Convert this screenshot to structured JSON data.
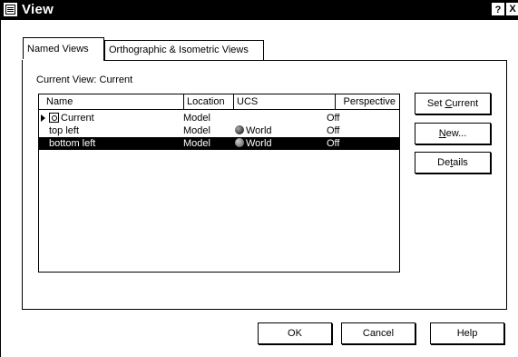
{
  "window": {
    "title": "View",
    "help_glyph": "?",
    "close_glyph": "X"
  },
  "tabs": [
    {
      "label": "Named Views",
      "active": true
    },
    {
      "label": "Orthographic & Isometric Views",
      "active": false
    }
  ],
  "current_view": {
    "label": "Current View:",
    "value": "Current"
  },
  "list": {
    "columns": [
      "Name",
      "Location",
      "UCS",
      "Perspective"
    ],
    "rows": [
      {
        "name": "Current",
        "location": "Model",
        "ucs": "",
        "perspective": "Off",
        "selected": false,
        "icons": [
          "current-arrow-icon",
          "camera-icon"
        ]
      },
      {
        "name": "top left",
        "location": "Model",
        "ucs": "World",
        "perspective": "Off",
        "selected": false,
        "icons": [
          "globe-icon"
        ]
      },
      {
        "name": "bottom left",
        "location": "Model",
        "ucs": "World",
        "perspective": "Off",
        "selected": true,
        "icons": [
          "globe-icon"
        ]
      }
    ]
  },
  "side_buttons": {
    "set_current": {
      "pre": "Set ",
      "key": "C",
      "post": "urrent"
    },
    "new": {
      "pre": "",
      "key": "N",
      "post": "ew..."
    },
    "details": {
      "pre": "De",
      "key": "t",
      "post": "ails"
    }
  },
  "footer_buttons": {
    "ok": "OK",
    "cancel": "Cancel",
    "help": "Help"
  }
}
